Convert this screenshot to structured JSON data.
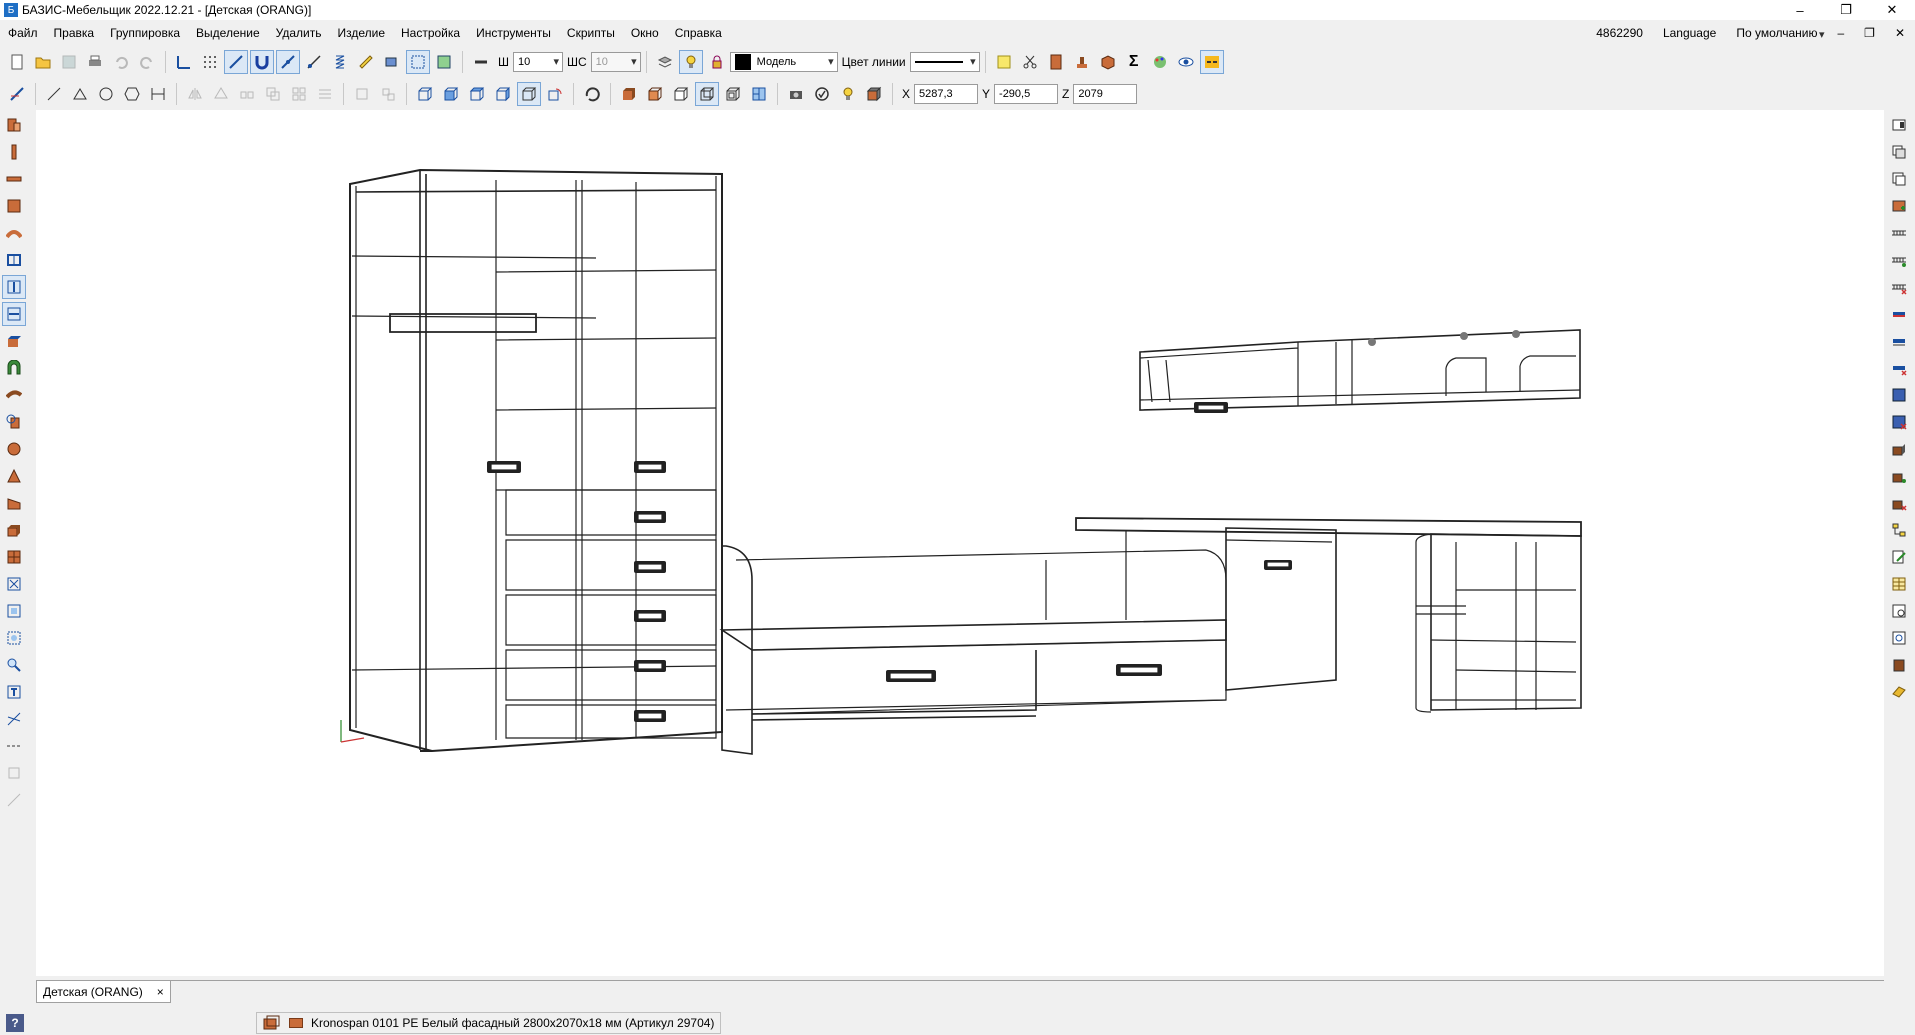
{
  "window": {
    "title": "БАЗИС-Мебельщик 2022.12.21 - [Детская (ORANG)]",
    "icon": "app-logo-icon"
  },
  "menu": {
    "items": [
      "Файл",
      "Правка",
      "Группировка",
      "Выделение",
      "Удалить",
      "Изделие",
      "Настройка",
      "Инструменты",
      "Скрипты",
      "Окно",
      "Справка"
    ],
    "right": {
      "id_number": "4862290",
      "language_label": "Language",
      "preset_label": "По умолчанию"
    }
  },
  "toolbar1": {
    "width_label": "Ш",
    "width_value": "10",
    "step_label": "ШС",
    "step_value": "10",
    "layer_value": "Модель",
    "line_color_label": "Цвет линии"
  },
  "toolbar2": {
    "x_label": "X",
    "x_value": "5287,3",
    "y_label": "Y",
    "y_value": "-290,5",
    "z_label": "Z",
    "z_value": "2079"
  },
  "tabs": {
    "active_label": "Детская (ORANG)",
    "close_glyph": "×"
  },
  "status": {
    "help_glyph": "?",
    "material_text": "Kronospan 0101 PE Белый фасадный 2800x2070x18 мм (Артикул 29704)"
  },
  "colors": {
    "accent": "#1f6fc5",
    "material": "#c96c3a"
  }
}
